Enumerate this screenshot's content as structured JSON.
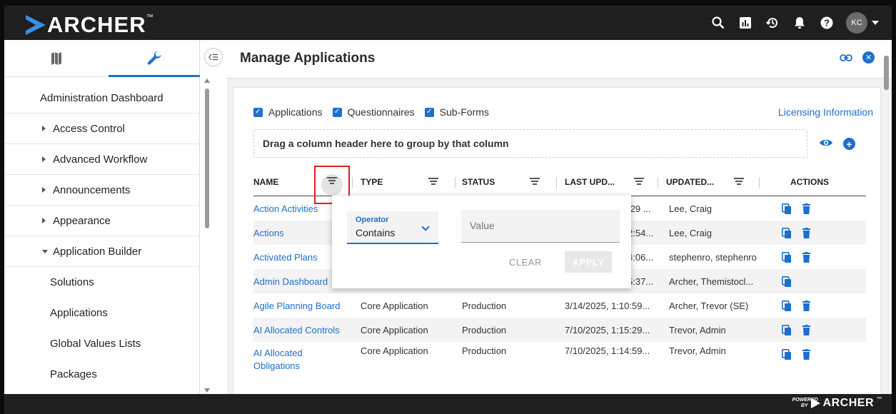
{
  "topbar": {
    "brand": "ARCHER",
    "brand_tm": "™",
    "avatar_initials": "KC",
    "icons": [
      "search-icon",
      "reports-icon",
      "history-icon",
      "bell-icon",
      "help-icon"
    ]
  },
  "left_panel": {
    "tabs": [
      "map-icon",
      "wrench-icon"
    ],
    "nav": [
      {
        "label": "Administration Dashboard"
      },
      {
        "label": "Access Control"
      },
      {
        "label": "Advanced Workflow"
      },
      {
        "label": "Announcements"
      },
      {
        "label": "Appearance"
      },
      {
        "label": "Application Builder"
      },
      {
        "label": "Solutions"
      },
      {
        "label": "Applications"
      },
      {
        "label": "Global Values Lists"
      },
      {
        "label": "Packages"
      }
    ]
  },
  "main": {
    "title": "Manage Applications",
    "filters": {
      "applications": "Applications",
      "questionnaires": "Questionnaires",
      "subforms": "Sub-Forms"
    },
    "licensing_link": "Licensing Information",
    "group_hint": "Drag a column header here to group by that column",
    "columns": [
      "NAME",
      "TYPE",
      "STATUS",
      "LAST UPD...",
      "UPDATED...",
      "ACTIONS"
    ],
    "rows": [
      {
        "name": "Action Activities",
        "type": "",
        "status": "",
        "last": ":29 ...",
        "by": "Lee, Craig"
      },
      {
        "name": "Actions",
        "type": "",
        "status": "",
        "last": "2:54...",
        "by": "Lee, Craig"
      },
      {
        "name": "Activated Plans",
        "type": "",
        "status": "",
        "last": "4:06...",
        "by": "stephenro, stephenro"
      },
      {
        "name": "Admin Dashboard",
        "type": "",
        "status": "",
        "last": "5:37...",
        "by": "Archer, Themistocl..."
      },
      {
        "name": "Agile Planning Board",
        "type": "Core Application",
        "status": "Production",
        "last": "3/14/2025, 1:10:59...",
        "by": "Archer, Trevor (SE)"
      },
      {
        "name": "AI Allocated Controls",
        "type": "Core Application",
        "status": "Production",
        "last": "7/10/2025, 1:15:29...",
        "by": "Trevor, Admin"
      },
      {
        "name": "AI Allocated",
        "name2": "Obligations",
        "type": "Core Application",
        "status": "Production",
        "last": "7/10/2025, 1:14:59...",
        "by": "Trevor, Admin"
      }
    ]
  },
  "filter_popup": {
    "operator_label": "Operator",
    "operator_value": "Contains",
    "value_placeholder": "Value",
    "clear": "CLEAR",
    "apply": "APPLY"
  },
  "footer": {
    "powered_by": "POWERED BY",
    "brand": "ARCHER",
    "brand_tm": "™"
  },
  "colors": {
    "accent": "#1e6fcc",
    "topbar": "#1f1f1f",
    "highlight": "#e01e1e"
  }
}
